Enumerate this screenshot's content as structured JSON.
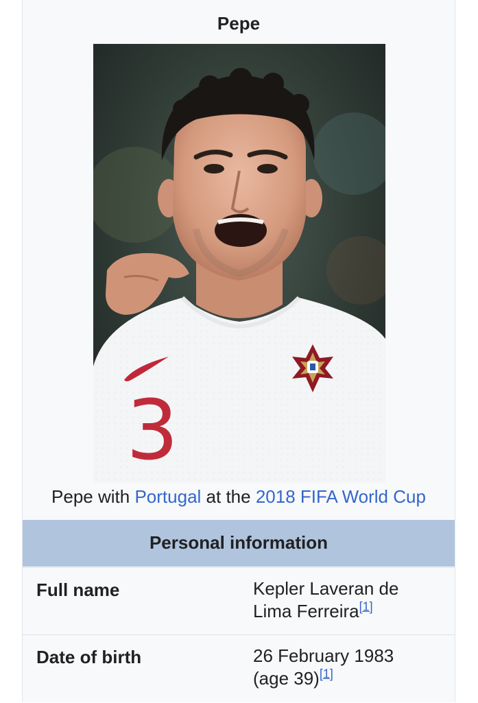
{
  "infobox": {
    "title": "Pepe",
    "image_alt": "Pepe with Portugal at the 2018 FIFA World Cup",
    "caption": {
      "prefix": "Pepe with",
      "link1": "Portugal",
      "middle": "at the",
      "link2": "2018 FIFA World Cup"
    },
    "jersey_number": "3",
    "section_header": "Personal information",
    "rows": [
      {
        "label": "Full name",
        "value_line1": "Kepler Laveran de",
        "value_line2": "Lima Ferreira",
        "ref": "[1]"
      },
      {
        "label": "Date of birth",
        "value_line1": "26 February 1983",
        "value_line2": "(age 39)",
        "ref": "[1]"
      }
    ]
  },
  "colors": {
    "link": "#3366cc",
    "section_header_bg": "#b0c4de",
    "infobox_bg": "#f8f9fa"
  }
}
